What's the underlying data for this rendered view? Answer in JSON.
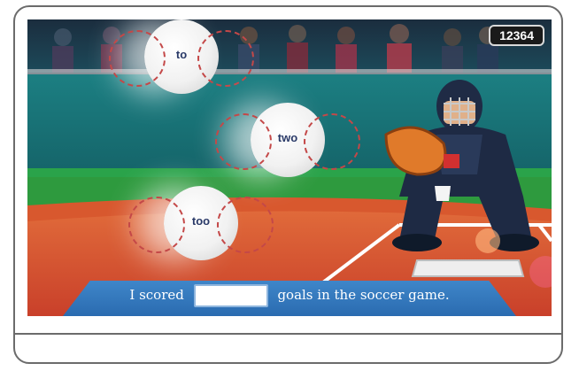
{
  "score": "12364",
  "balls": [
    {
      "word": "to"
    },
    {
      "word": "two"
    },
    {
      "word": "too"
    }
  ],
  "prompt": {
    "before": "I scored",
    "after": "goals in the soccer game."
  },
  "colors": {
    "frame": "#6b6b6b",
    "prompt_bar": "#2f74b8",
    "field_orange": "#d8532c",
    "grass": "#2e9a3e",
    "word_text": "#2a3a68"
  }
}
